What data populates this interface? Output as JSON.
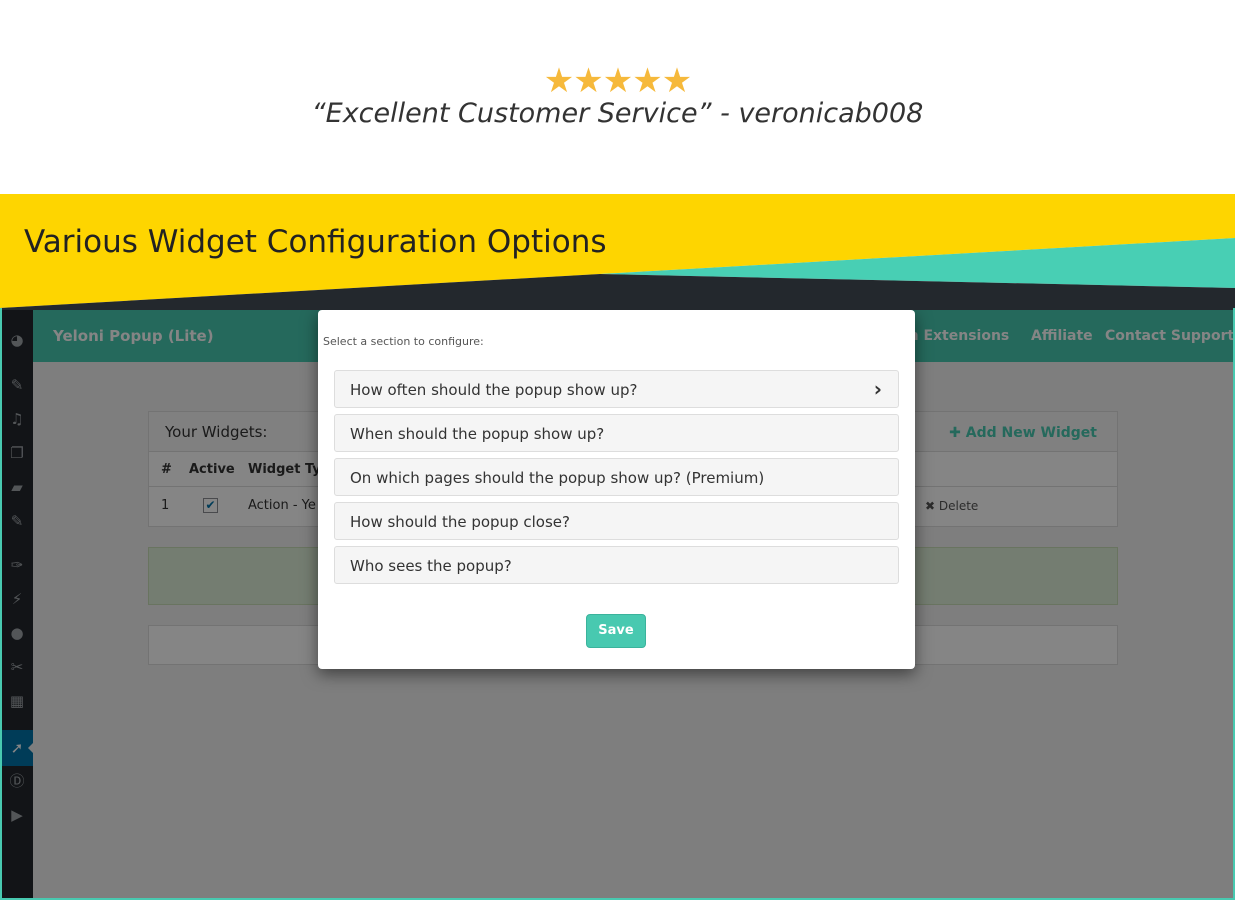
{
  "testimonial": {
    "stars": "★★★★★",
    "rating": 5,
    "quote": "“Excellent Customer Service” - veronicab008"
  },
  "banner": {
    "title": "Various Widget Configuration Options",
    "colors": {
      "yellow": "#fed500",
      "teal": "#48cfb4",
      "dark": "#23282d"
    }
  },
  "wp": {
    "brand": "Yeloni Popup (Lite)",
    "nav": [
      "m Extensions",
      "Affiliate",
      "Contact Support"
    ],
    "panel": {
      "title": "Your Widgets:",
      "add_new": "✚ Add New Widget",
      "columns": [
        "#",
        "Active",
        "Widget Ty"
      ],
      "row": {
        "num": "1",
        "checked": "✔",
        "type": "Action - Ye",
        "delete": "✖ Delete"
      }
    },
    "sidebar_icons": [
      "dashboard-icon",
      "pin-icon",
      "media-icon",
      "pages-icon",
      "comments-icon",
      "pin-icon",
      "appearance-icon",
      "plugins-icon",
      "users-icon",
      "tools-icon",
      "settings-icon",
      "pointer-icon",
      "divi-icon",
      "play-icon"
    ]
  },
  "modal": {
    "hint": "Select a section to configure:",
    "sections": [
      "How often should the popup show up?",
      "When should the popup show up?",
      "On which pages should the popup show up? (Premium)",
      "How should the popup close?",
      "Who sees the popup?"
    ],
    "chevron": "›",
    "save_label": "Save"
  }
}
